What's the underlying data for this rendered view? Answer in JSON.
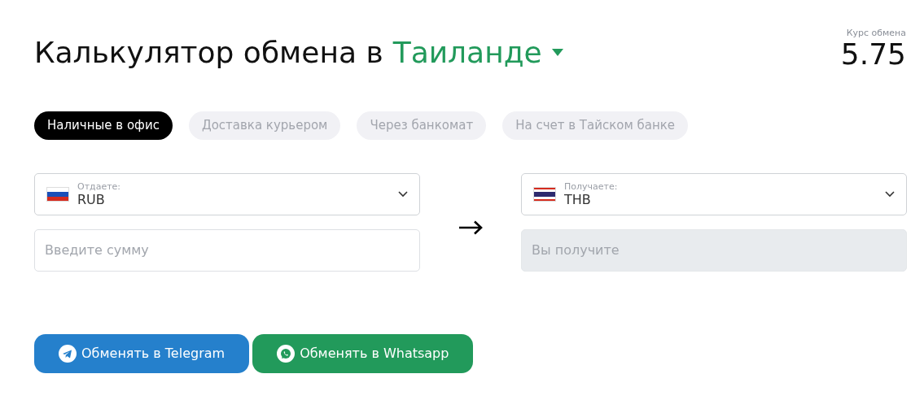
{
  "title": {
    "text": "Калькулятор обмена в",
    "location": "Таиланде"
  },
  "rate": {
    "label": "Курс обмена",
    "value": "5.75"
  },
  "tabs": [
    {
      "label": "Наличные в офис",
      "selected": true
    },
    {
      "label": "Доставка курьером",
      "selected": false
    },
    {
      "label": "Через банкомат",
      "selected": false
    },
    {
      "label": "На счет в Тайском банке",
      "selected": false
    }
  ],
  "give": {
    "label": "Отдаете:",
    "currency": "RUB",
    "flag": {
      "kind": "ru"
    },
    "input": {
      "placeholder": "Введите сумму",
      "disabled": false
    }
  },
  "receive": {
    "label": "Получаете:",
    "currency": "THB",
    "flag": {
      "kind": "th"
    },
    "input": {
      "placeholder": "Вы получите",
      "disabled": true
    }
  },
  "buttons": [
    {
      "label": "Обменять в Telegram",
      "kind": "telegram"
    },
    {
      "label": "Обменять в Whatsapp",
      "kind": "whatsapp"
    }
  ]
}
